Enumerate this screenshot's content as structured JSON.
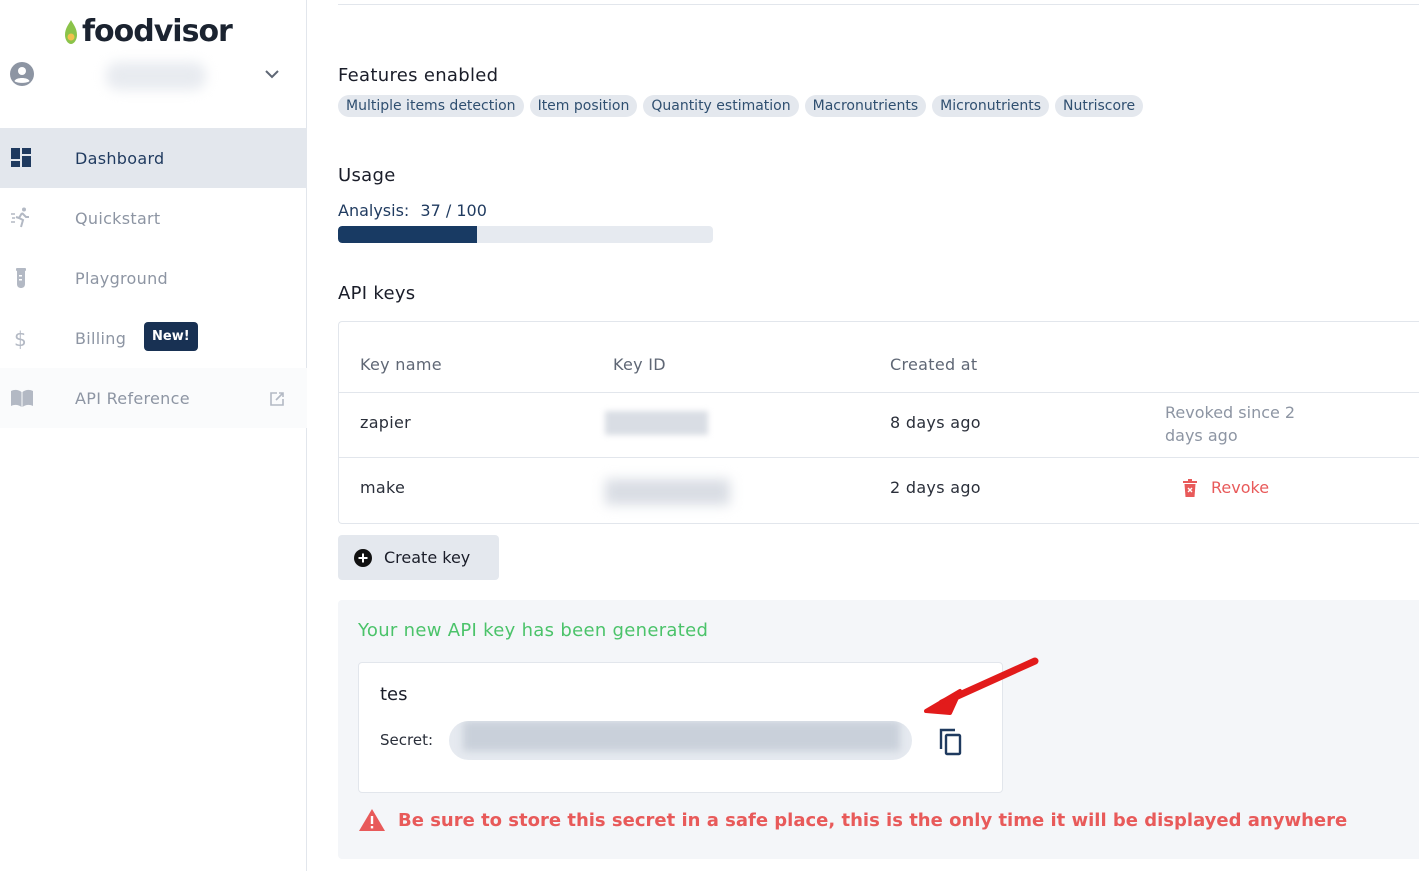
{
  "brand": {
    "name": "foodvisor"
  },
  "sidebar": {
    "items": [
      {
        "label": "Dashboard",
        "icon": "dashboard-icon"
      },
      {
        "label": "Quickstart",
        "icon": "runner-icon"
      },
      {
        "label": "Playground",
        "icon": "flask-icon"
      },
      {
        "label": "Billing",
        "icon": "dollar-icon",
        "badge": "New!"
      },
      {
        "label": "API Reference",
        "icon": "book-icon"
      }
    ]
  },
  "features": {
    "title": "Features enabled",
    "tags": [
      "Multiple items detection",
      "Item position",
      "Quantity estimation",
      "Macronutrients",
      "Micronutrients",
      "Nutriscore"
    ]
  },
  "usage": {
    "title": "Usage",
    "label": "Analysis:",
    "value_text": "37 / 100",
    "used": 37,
    "total": 100
  },
  "api_keys": {
    "title": "API keys",
    "headers": {
      "name": "Key name",
      "id": "Key ID",
      "created": "Created at"
    },
    "rows": [
      {
        "name": "zapier",
        "created": "8 days ago",
        "status": "Revoked since 2 days ago"
      },
      {
        "name": "make",
        "created": "2 days ago",
        "action": "Revoke"
      }
    ],
    "create_label": "Create key"
  },
  "generated": {
    "title": "Your new API key has been generated",
    "key_name": "tes",
    "secret_label": "Secret:",
    "warning": "Be sure to store this secret in a safe place, this is the only time it will be displayed anywhere"
  },
  "colors": {
    "accent": "#183153",
    "success": "#4bc36a",
    "danger": "#e85a5a"
  }
}
